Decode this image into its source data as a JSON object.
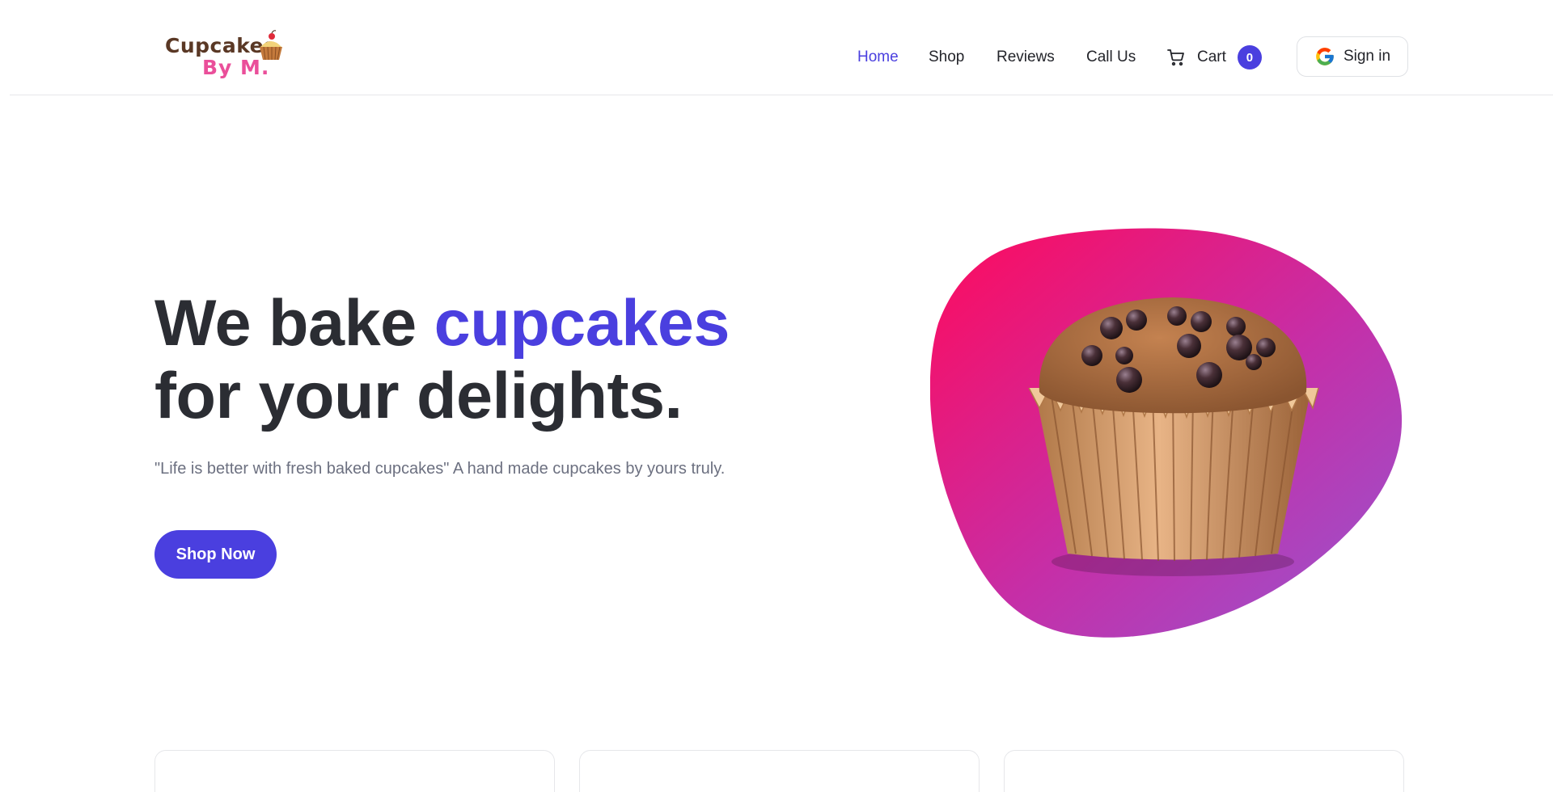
{
  "brand": {
    "line1": "Cupcakes",
    "line2": "By M.",
    "primary_color": "#4a3fdf",
    "logo_brown": "#5a3825",
    "logo_pink": "#ea4f9a"
  },
  "nav": {
    "items": [
      {
        "label": "Home",
        "active": true
      },
      {
        "label": "Shop",
        "active": false
      },
      {
        "label": "Reviews",
        "active": false
      },
      {
        "label": "Call Us",
        "active": false
      }
    ],
    "cart": {
      "label": "Cart",
      "count": "0",
      "icon": "cart-icon"
    },
    "signin": {
      "label": "Sign in",
      "icon": "google-icon"
    }
  },
  "hero": {
    "title_part1": "We bake ",
    "title_accent": "cupcakes",
    "title_part2": "for your delights.",
    "subtitle": "\"Life is better with fresh baked cupcakes\" A hand made cupcakes by yours truly.",
    "cta_label": "Shop Now",
    "blob_gradient": [
      "#ff0a5c",
      "#c52fa8",
      "#9656d0"
    ]
  },
  "feature_cards": [
    {
      "id": "card-1"
    },
    {
      "id": "card-2"
    },
    {
      "id": "card-3"
    }
  ]
}
